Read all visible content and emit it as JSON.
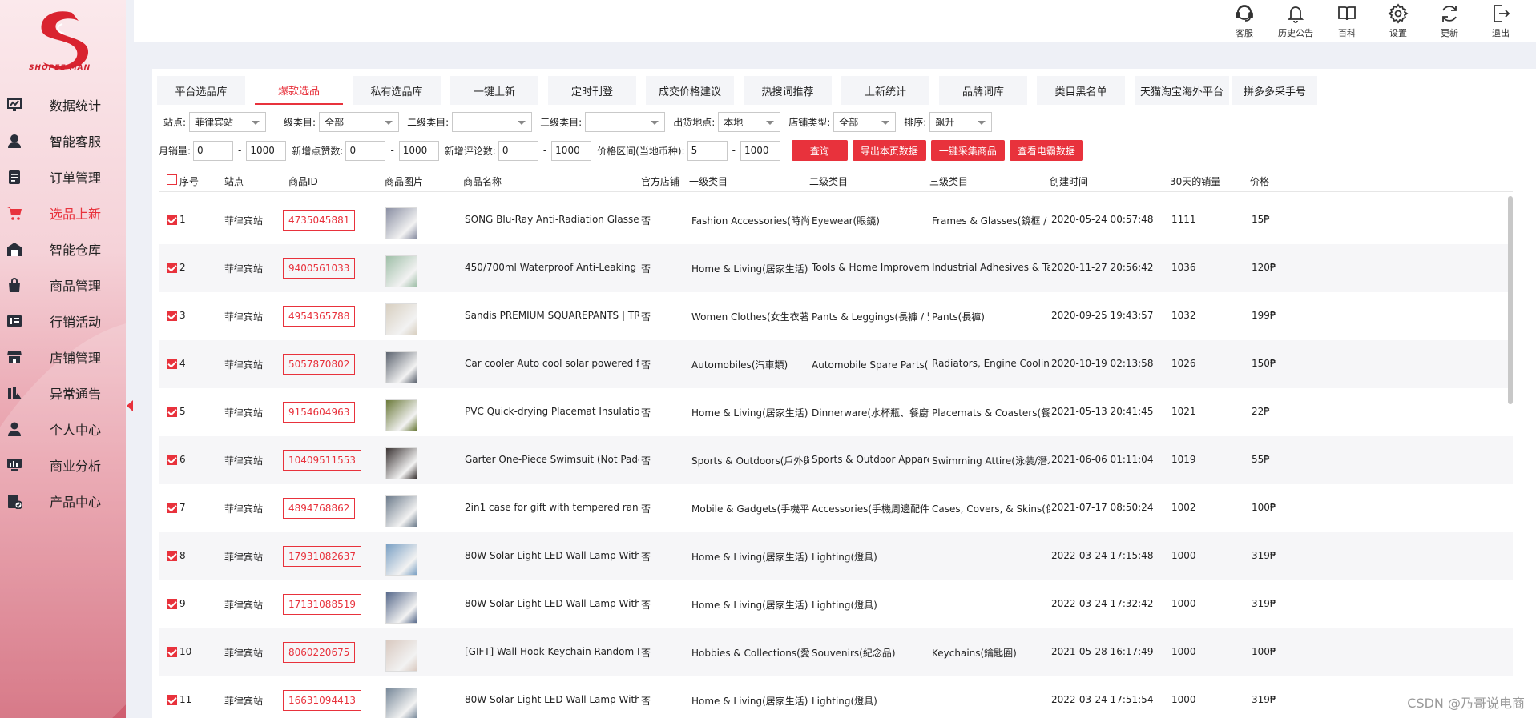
{
  "brand": {
    "logo_text": "SHOPEE MAN"
  },
  "sidebar": {
    "items": [
      {
        "label": "数据统计",
        "icon": "chart-icon"
      },
      {
        "label": "智能客服",
        "icon": "user-service-icon"
      },
      {
        "label": "订单管理",
        "icon": "document-icon"
      },
      {
        "label": "选品上新",
        "icon": "cart-icon",
        "active": true
      },
      {
        "label": "智能仓库",
        "icon": "warehouse-icon"
      },
      {
        "label": "商品管理",
        "icon": "bag-icon"
      },
      {
        "label": "行销活动",
        "icon": "campaign-icon"
      },
      {
        "label": "店铺管理",
        "icon": "store-icon"
      },
      {
        "label": "异常通告",
        "icon": "alert-icon"
      },
      {
        "label": "个人中心",
        "icon": "person-icon"
      },
      {
        "label": "商业分析",
        "icon": "analytics-icon"
      },
      {
        "label": "产品中心",
        "icon": "product-icon"
      }
    ]
  },
  "topbar": {
    "actions": [
      {
        "label": "客服",
        "icon": "headset-icon"
      },
      {
        "label": "历史公告",
        "icon": "bell-icon"
      },
      {
        "label": "百科",
        "icon": "book-icon"
      },
      {
        "label": "设置",
        "icon": "gear-icon"
      },
      {
        "label": "更新",
        "icon": "refresh-icon"
      },
      {
        "label": "退出",
        "icon": "logout-icon"
      }
    ]
  },
  "tabs": [
    {
      "label": "平台选品库"
    },
    {
      "label": "爆款选品",
      "active": true
    },
    {
      "label": "私有选品库"
    },
    {
      "label": "一键上新"
    },
    {
      "label": "定时刊登"
    },
    {
      "label": "成交价格建议"
    },
    {
      "label": "热搜词推荐"
    },
    {
      "label": "上新统计"
    },
    {
      "label": "品牌词库"
    },
    {
      "label": "类目黑名单"
    },
    {
      "label": "天猫淘宝海外平台"
    },
    {
      "label": "拼多多采手号"
    }
  ],
  "filters": {
    "site_label": "站点:",
    "site_value": "菲律宾站",
    "cat1_label": "一级类目:",
    "cat1_value": "全部",
    "cat2_label": "二级类目:",
    "cat2_value": "",
    "cat3_label": "三级类目:",
    "cat3_value": "",
    "ship_label": "出货地点:",
    "ship_value": "本地",
    "shoptype_label": "店铺类型:",
    "shoptype_value": "全部",
    "sort_label": "排序:",
    "sort_value": "飙升",
    "monthly_label": "月销量:",
    "monthly_min": "0",
    "monthly_max": "1000",
    "likes_label": "新增点赞数:",
    "likes_min": "0",
    "likes_max": "1000",
    "reviews_label": "新增评论数:",
    "reviews_min": "0",
    "reviews_max": "1000",
    "price_label": "价格区间(当地币种):",
    "price_min": "5",
    "price_max": "1000",
    "dash": "-",
    "buttons": {
      "query": "查询",
      "export": "导出本页数据",
      "collect": "一键采集商品",
      "view": "查看电霸数据"
    }
  },
  "table": {
    "columns": [
      "序号",
      "站点",
      "商品ID",
      "商品图片",
      "商品名称",
      "官方店铺",
      "一级类目",
      "二级类目",
      "三级类目",
      "创建时间",
      "30天的销量",
      "价格"
    ],
    "rows": [
      {
        "no": "1",
        "site": "菲律宾站",
        "id": "4735045881",
        "name": "SONG Blu-Ray Anti-Radiation Glasses",
        "official": "否",
        "cat1": "Fashion Accessories(時尚飾",
        "cat2": "Eyewear(眼鏡)",
        "cat3": "Frames & Glasses(鏡框 / 刻",
        "created": "2020-05-24 00:57:48",
        "sales": "1111",
        "price": "15₱"
      },
      {
        "no": "2",
        "site": "菲律宾站",
        "id": "9400561033",
        "name": "450/700ml Waterproof Anti-Leaking S",
        "official": "否",
        "cat1": "Home & Living(居家生活)",
        "cat2": "Tools & Home Improvem",
        "cat3": "Industrial Adhesives & Ta",
        "created": "2020-11-27 20:56:42",
        "sales": "1036",
        "price": "120₱"
      },
      {
        "no": "3",
        "site": "菲律宾站",
        "id": "4954365788",
        "name": "Sandis PREMIUM SQUAREPANTS | TR",
        "official": "否",
        "cat1": "Women Clothes(女生衣著",
        "cat2": "Pants & Leggings(長褲 / 緊",
        "cat3": "Pants(長褲)",
        "created": "2020-09-25 19:43:57",
        "sales": "1032",
        "price": "199₱"
      },
      {
        "no": "4",
        "site": "菲律宾站",
        "id": "5057870802",
        "name": "Car cooler Auto cool solar powered fa",
        "official": "否",
        "cat1": "Automobiles(汽車類)",
        "cat2": "Automobile Spare Parts(汽",
        "cat3": "Radiators, Engine Cooling",
        "created": "2020-10-19 02:13:58",
        "sales": "1026",
        "price": "150₱"
      },
      {
        "no": "5",
        "site": "菲律宾站",
        "id": "9154604963",
        "name": "PVC Quick-drying Placemat Insulation",
        "official": "否",
        "cat1": "Home & Living(居家生活)",
        "cat2": "Dinnerware(水杯瓶、餐廚",
        "cat3": "Placemats & Coasters(餐墊",
        "created": "2021-05-13 20:41:45",
        "sales": "1021",
        "price": "22₱"
      },
      {
        "no": "6",
        "site": "菲律宾站",
        "id": "10409511553",
        "name": "Garter One-Piece Swimsuit (Not Padd",
        "official": "否",
        "cat1": "Sports & Outdoors(戶外與",
        "cat2": "Sports & Outdoor Appare",
        "cat3": "Swimming Attire(泳裝/潛水",
        "created": "2021-06-06 01:11:04",
        "sales": "1019",
        "price": "55₱"
      },
      {
        "no": "7",
        "site": "菲律宾站",
        "id": "4894768862",
        "name": "2in1 case for gift with tempered rand",
        "official": "否",
        "cat1": "Mobile & Gadgets(手機平",
        "cat2": "Accessories(手機周邊配件)",
        "cat3": "Cases, Covers, & Skins(保",
        "created": "2021-07-17 08:50:24",
        "sales": "1002",
        "price": "100₱"
      },
      {
        "no": "8",
        "site": "菲律宾站",
        "id": "17931082637",
        "name": "80W Solar Light LED Wall Lamp With",
        "official": "否",
        "cat1": "Home & Living(居家生活)",
        "cat2": "Lighting(燈具)",
        "cat3": "",
        "created": "2022-03-24 17:15:48",
        "sales": "1000",
        "price": "319₱"
      },
      {
        "no": "9",
        "site": "菲律宾站",
        "id": "17131088519",
        "name": "80W Solar Light LED Wall Lamp With",
        "official": "否",
        "cat1": "Home & Living(居家生活)",
        "cat2": "Lighting(燈具)",
        "cat3": "",
        "created": "2022-03-24 17:32:42",
        "sales": "1000",
        "price": "319₱"
      },
      {
        "no": "10",
        "site": "菲律宾站",
        "id": "8060220675",
        "name": "[GIFT] Wall Hook Keychain Random D",
        "official": "否",
        "cat1": "Hobbies & Collections(愛",
        "cat2": "Souvenirs(紀念品)",
        "cat3": "Keychains(鑰匙圈)",
        "created": "2021-05-28 16:17:49",
        "sales": "1000",
        "price": "100₱"
      },
      {
        "no": "11",
        "site": "菲律宾站",
        "id": "16631094413",
        "name": "80W Solar Light LED Wall Lamp With",
        "official": "否",
        "cat1": "Home & Living(居家生活)",
        "cat2": "Lighting(燈具)",
        "cat3": "",
        "created": "2022-03-24 17:51:54",
        "sales": "1000",
        "price": "319₱"
      }
    ]
  },
  "watermark": "CSDN @乃哥说电商",
  "colors": {
    "accent": "#e8323c",
    "sidebar": "#f5d2d8",
    "background": "#eef0f6"
  }
}
